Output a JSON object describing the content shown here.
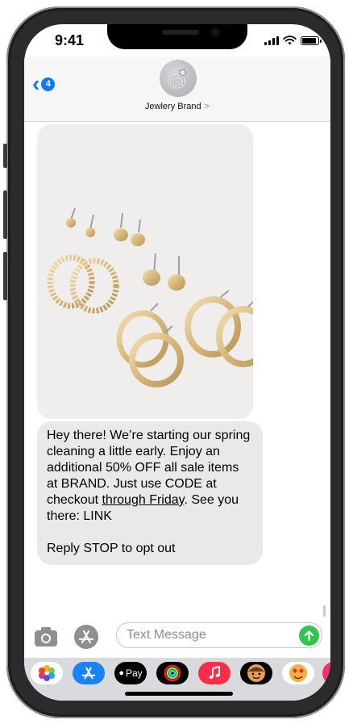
{
  "status_bar": {
    "time": "9:41"
  },
  "header": {
    "back_badge": "4",
    "contact_name": "Jewlery Brand",
    "contact_chevron": ">"
  },
  "message": {
    "line1": "Hey there! We’re starting our spring cleaning a little early. Enjoy an additional 50% OFF all sale items at BRAND. Just use CODE at checkout ",
    "underlined": "through Friday",
    "line2": ". See you there: LINK",
    "opt_out": "Reply STOP to opt out"
  },
  "composer": {
    "placeholder": "Text Message"
  },
  "app_strip": {
    "apple_pay_label": "Pay",
    "items": [
      "photos-app",
      "app-store-app",
      "apple-pay-app",
      "activity-app",
      "music-app",
      "memoji-app",
      "animoji-app",
      "digital-touch-app"
    ]
  },
  "colors": {
    "accent": "#0a7aff",
    "send": "#30c54d",
    "bubble": "#e9e9eb"
  },
  "icons": [
    "back-chevron-icon",
    "ring-icon",
    "camera-icon",
    "app-store-icon",
    "send-arrow-icon"
  ]
}
